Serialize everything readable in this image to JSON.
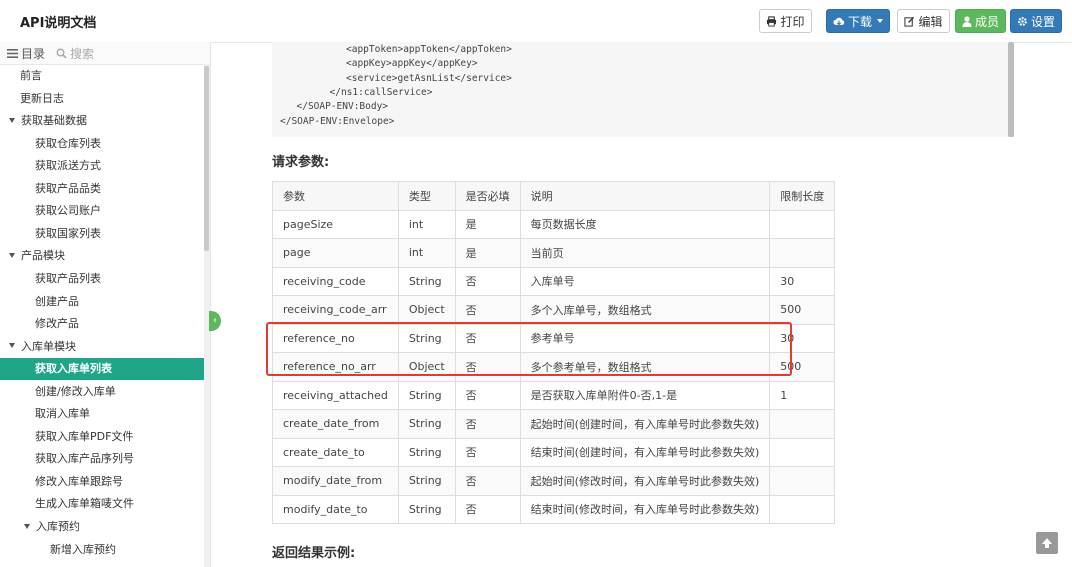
{
  "header": {
    "title": "API说明文档",
    "buttons": [
      {
        "label": "打印",
        "icon": "print-icon"
      },
      {
        "label": "下载",
        "icon": "cloud-download-icon"
      },
      {
        "label": "编辑",
        "icon": "edit-icon"
      },
      {
        "label": "成员",
        "icon": "user-icon"
      },
      {
        "label": "设置",
        "icon": "gear-icon"
      }
    ]
  },
  "sidebar": {
    "tabs": [
      {
        "label": "目录",
        "icon": "list-icon"
      },
      {
        "label": "搜索",
        "icon": "search-icon"
      }
    ],
    "items": [
      {
        "label": "前言",
        "level": 0,
        "group": false
      },
      {
        "label": "更新日志",
        "level": 0,
        "group": false
      },
      {
        "label": "获取基础数据",
        "level": 0,
        "group": true
      },
      {
        "label": "获取仓库列表",
        "level": 1,
        "group": false
      },
      {
        "label": "获取派送方式",
        "level": 1,
        "group": false
      },
      {
        "label": "获取产品品类",
        "level": 1,
        "group": false
      },
      {
        "label": "获取公司账户",
        "level": 1,
        "group": false
      },
      {
        "label": "获取国家列表",
        "level": 1,
        "group": false
      },
      {
        "label": "产品模块",
        "level": 0,
        "group": true
      },
      {
        "label": "获取产品列表",
        "level": 1,
        "group": false
      },
      {
        "label": "创建产品",
        "level": 1,
        "group": false
      },
      {
        "label": "修改产品",
        "level": 1,
        "group": false
      },
      {
        "label": "入库单模块",
        "level": 0,
        "group": true
      },
      {
        "label": "获取入库单列表",
        "level": 1,
        "group": false,
        "active": true
      },
      {
        "label": "创建/修改入库单",
        "level": 1,
        "group": false
      },
      {
        "label": "取消入库单",
        "level": 1,
        "group": false
      },
      {
        "label": "获取入库单PDF文件",
        "level": 1,
        "group": false
      },
      {
        "label": "获取入库产品序列号",
        "level": 1,
        "group": false
      },
      {
        "label": "修改入库单跟踪号",
        "level": 1,
        "group": false
      },
      {
        "label": "生成入库单箱唛文件",
        "level": 1,
        "group": false
      },
      {
        "label": "入库预约",
        "level": 1,
        "group": true
      },
      {
        "label": "新增入库预约",
        "level": 2,
        "group": false
      }
    ]
  },
  "code": {
    "lines": [
      {
        "text": "<appToken>appToken</appToken>",
        "indent": 4
      },
      {
        "text": "<appKey>appKey</appKey>",
        "indent": 4
      },
      {
        "text": "<service>getAsnList</service>",
        "indent": 4
      },
      {
        "text": "</ns1:callService>",
        "indent": 3
      },
      {
        "text": "</SOAP-ENV:Body>",
        "indent": 1
      },
      {
        "text": "</SOAP-ENV:Envelope>",
        "indent": 0
      }
    ]
  },
  "request_params": {
    "title": "请求参数:",
    "columns": [
      "参数",
      "类型",
      "是否必填",
      "说明",
      "限制长度"
    ],
    "rows": [
      [
        "pageSize",
        "int",
        "是",
        "每页数据长度",
        ""
      ],
      [
        "page",
        "int",
        "是",
        "当前页",
        ""
      ],
      [
        "receiving_code",
        "String",
        "否",
        "入库单号",
        "30"
      ],
      [
        "receiving_code_arr",
        "Object",
        "否",
        "多个入库单号，数组格式",
        "500"
      ],
      [
        "reference_no",
        "String",
        "否",
        "参考单号",
        "30"
      ],
      [
        "reference_no_arr",
        "Object",
        "否",
        "多个参考单号，数组格式",
        "500"
      ],
      [
        "receiving_attached",
        "String",
        "否",
        "是否获取入库单附件0-否,1-是",
        "1"
      ],
      [
        "create_date_from",
        "String",
        "否",
        "起始时间(创建时间，有入库单号时此参数失效)",
        ""
      ],
      [
        "create_date_to",
        "String",
        "否",
        "结束时间(创建时间，有入库单号时此参数失效)",
        ""
      ],
      [
        "modify_date_from",
        "String",
        "否",
        "起始时间(修改时间，有入库单号时此参数失效)",
        ""
      ],
      [
        "modify_date_to",
        "String",
        "否",
        "结束时间(修改时间，有入库单号时此参数失效)",
        ""
      ]
    ]
  },
  "response": {
    "title": "返回结果示例:"
  },
  "colors": {
    "accent_active": "#1fa689",
    "primary": "#337ab7",
    "success": "#5cb85c",
    "highlight": "#e53935"
  }
}
